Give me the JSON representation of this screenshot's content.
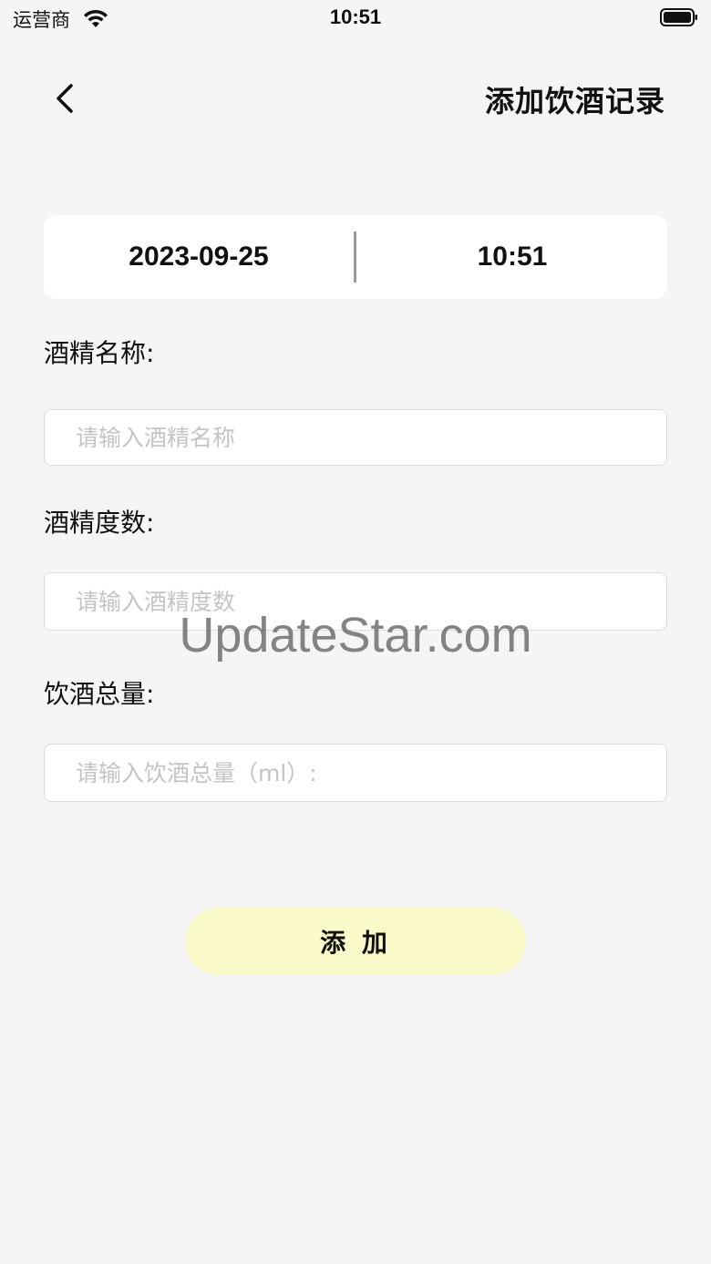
{
  "status_bar": {
    "carrier": "运营商",
    "time": "10:51",
    "wifi_icon": "wifi-icon",
    "battery_icon": "battery-icon"
  },
  "header": {
    "back_icon": "chevron-left-icon",
    "title": "添加饮酒记录"
  },
  "datetime": {
    "date": "2023-09-25",
    "time": "10:51"
  },
  "form": {
    "alcohol_name": {
      "label": "酒精名称:",
      "placeholder": "请输入酒精名称",
      "value": ""
    },
    "alcohol_degree": {
      "label": "酒精度数:",
      "placeholder": "请输入酒精度数",
      "value": ""
    },
    "total_amount": {
      "label": "饮酒总量:",
      "placeholder": "请输入饮酒总量（ml）:",
      "value": ""
    }
  },
  "actions": {
    "add_label": "添 加"
  },
  "watermark": "UpdateStar.com",
  "colors": {
    "background": "#f5f5f5",
    "card": "#ffffff",
    "button": "#fafacb"
  }
}
